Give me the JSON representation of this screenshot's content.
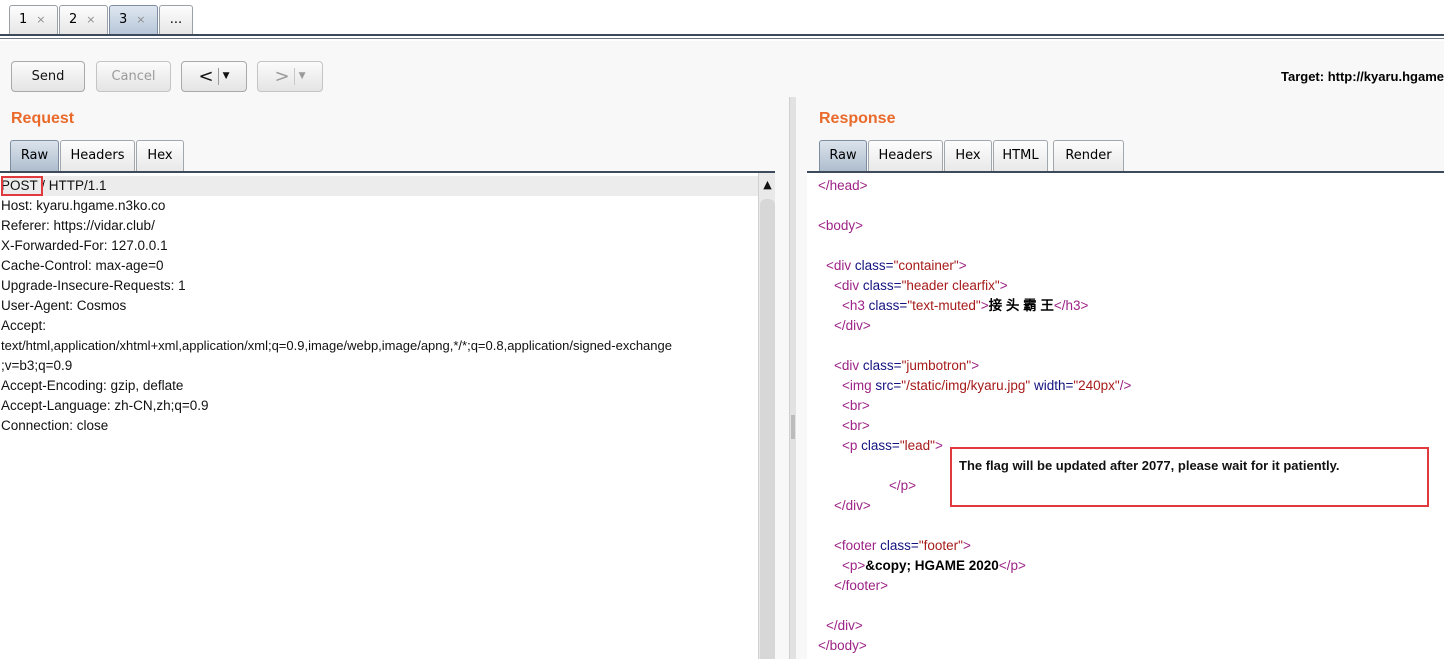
{
  "tabs": [
    {
      "label": "1",
      "close": "×"
    },
    {
      "label": "2",
      "close": "×"
    },
    {
      "label": "3",
      "close": "×"
    },
    {
      "label": "..."
    }
  ],
  "toolbar": {
    "send_label": "Send",
    "cancel_label": "Cancel",
    "back_label": "<",
    "forward_label": ">",
    "dropdown_glyph": "▼",
    "target_text": "Target: http://kyaru.hgame"
  },
  "request": {
    "title": "Request",
    "tabs": [
      "Raw",
      "Headers",
      "Hex"
    ],
    "lines": [
      "POST / HTTP/1.1",
      "Host: kyaru.hgame.n3ko.co",
      "Referer: https://vidar.club/",
      "X-Forwarded-For: 127.0.0.1",
      "Cache-Control: max-age=0",
      "Upgrade-Insecure-Requests: 1",
      "User-Agent: Cosmos",
      "Accept:",
      "text/html,application/xhtml+xml,application/xml;q=0.9,image/webp,image/apng,*/*;q=0.8,application/signed-exchange",
      ";v=b3;q=0.9",
      "Accept-Encoding: gzip, deflate",
      "Accept-Language: zh-CN,zh;q=0.9",
      "Connection: close"
    ]
  },
  "response": {
    "title": "Response",
    "tabs": [
      "Raw",
      "Headers",
      "Hex",
      "HTML",
      "Render"
    ],
    "html": {
      "head_close": "</head>",
      "body_open": "<body>",
      "div": "<div",
      "div_close": "</div>",
      "class_attr": "class=",
      "container_val": "\"container\"",
      "header_val": "\"header clearfix\"",
      "h3_open": "<h3",
      "text_muted_val": "\"text-muted\"",
      "h3_text": "接 头 霸 王",
      "h3_close": "</h3>",
      "jumbotron_val": "\"jumbotron\"",
      "img_open": "<img",
      "src_attr": "src=",
      "src_val": "\"/static/img/kyaru.jpg\"",
      "width_attr": "width=",
      "width_val": "\"240px\"",
      "self_close": "/>",
      "gt": ">",
      "br": "<br>",
      "p_open": "<p",
      "lead_val": "\"lead\"",
      "p_close": "</p>",
      "footer_open": "<footer",
      "footer_val": "\"footer\"",
      "p_simple_open": "<p>",
      "copyright_text": "&copy; HGAME 2020",
      "footer_close": "</footer>",
      "body_close": "</body>"
    },
    "flag_message": "The flag will be updated after 2077, please wait for it patiently."
  }
}
